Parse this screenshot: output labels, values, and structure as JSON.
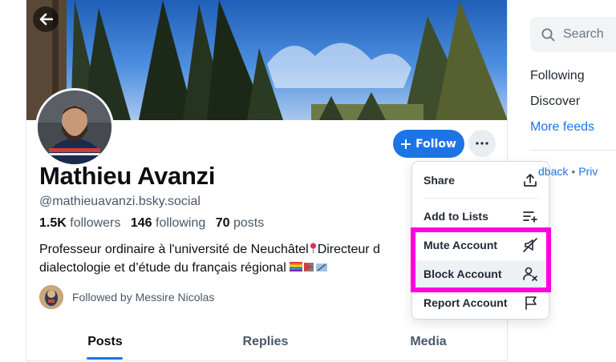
{
  "profile": {
    "display_name": "Mathieu Avanzi",
    "handle": "@mathieuavanzi.bsky.social",
    "followers_count": "1.5K",
    "followers_label": "followers",
    "following_count": "146",
    "following_label": "following",
    "posts_count": "70",
    "posts_label": "posts",
    "bio_line1_a": "Professeur ordinaire à l'université de Neuchâtel",
    "bio_line1_b": "Directeur d",
    "bio_line2": "dialectologie et d’étude du français régional",
    "followed_by": "Followed by Messire Nicolas"
  },
  "actions": {
    "follow_label": "Follow"
  },
  "tabs": [
    {
      "label": "Posts",
      "active": true
    },
    {
      "label": "Replies",
      "active": false
    },
    {
      "label": "Media",
      "active": false
    }
  ],
  "menu": {
    "items": [
      {
        "label": "Share",
        "icon": "share-icon"
      },
      {
        "label": "Add to Lists",
        "icon": "add-to-list-icon"
      },
      {
        "label": "Mute Account",
        "icon": "mute-icon"
      },
      {
        "label": "Block Account",
        "icon": "block-user-icon"
      },
      {
        "label": "Report Account",
        "icon": "flag-icon"
      }
    ]
  },
  "sidebar": {
    "search_placeholder": "Search",
    "links": [
      {
        "label": "Following",
        "color": "#1f2933"
      },
      {
        "label": "Discover",
        "color": "#1f2933"
      },
      {
        "label": "More feeds",
        "color": "#1d74e5"
      }
    ],
    "footer_feedback": "dback",
    "footer_privacy": "Priv"
  },
  "colors": {
    "accent": "#1d74e5",
    "annotation": "#ff00dc"
  }
}
